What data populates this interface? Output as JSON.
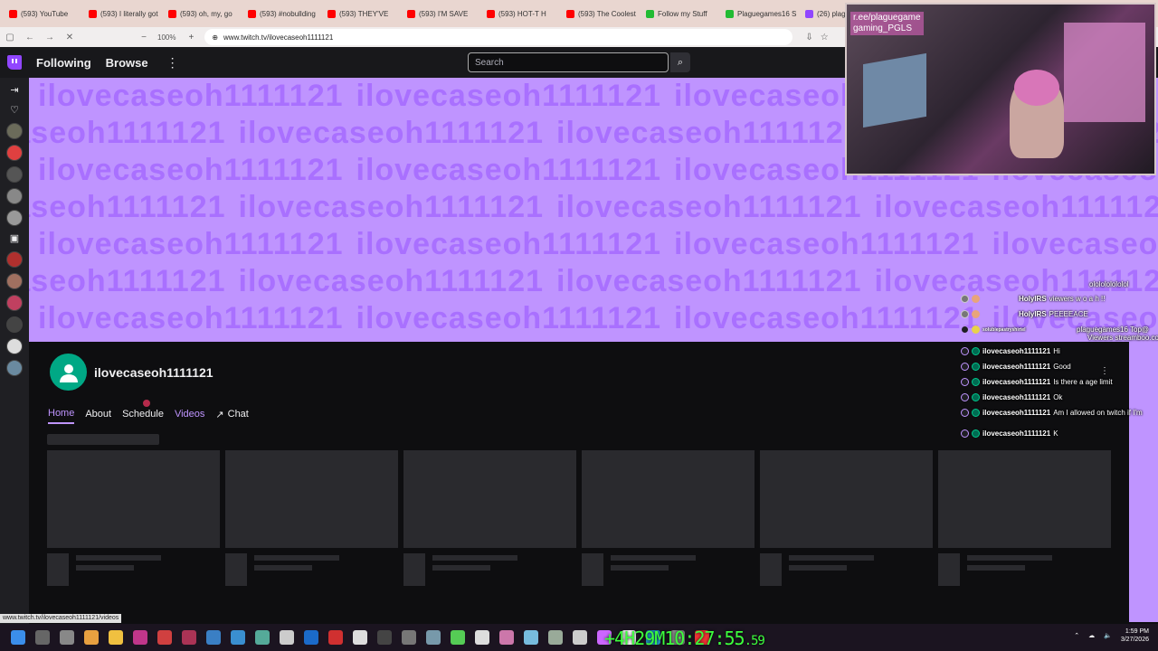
{
  "browser": {
    "tabs": [
      {
        "label": "(593) YouTube",
        "color": "#ff0000"
      },
      {
        "label": "(593) I literally got",
        "color": "#ff0000"
      },
      {
        "label": "(593) oh, my, go",
        "color": "#ff0000"
      },
      {
        "label": "(593) #nobullding",
        "color": "#ff0000"
      },
      {
        "label": "(593) THEY'VE",
        "color": "#ff0000"
      },
      {
        "label": "(593) I'M SAVE",
        "color": "#ff0000"
      },
      {
        "label": "(593) HOT-T H",
        "color": "#ff0000"
      },
      {
        "label": "(593) The Coolest",
        "color": "#ff0000"
      },
      {
        "label": "Follow my Stuff",
        "color": "#22bb33"
      },
      {
        "label": "Plaguegames16 S",
        "color": "#22bb33"
      },
      {
        "label": "(26) plaguegam",
        "color": "#9146ff"
      }
    ],
    "zoom": "100%",
    "url": "www.twitch.tv/ilovecaseoh1111121",
    "status_url": "www.twitch.tv/ilovecaseoh1111121/videos"
  },
  "topnav": {
    "following": "Following",
    "browse": "Browse",
    "more": "⋮",
    "search_placeholder": "Search"
  },
  "banner": {
    "text": "ilovecaseoh1111121"
  },
  "channel": {
    "name": "ilovecaseoh1111121",
    "tabs": {
      "home": "Home",
      "about": "About",
      "schedule": "Schedule",
      "videos": "Videos",
      "chat": "Chat"
    }
  },
  "stream_overlay": {
    "cam_text_1": "r.ee/plaguegame",
    "cam_text_2": "gaming_PGLS",
    "chat": [
      {
        "name": "",
        "text": "ololololololol"
      },
      {
        "name": "HolyIRS",
        "text": "viewers w o a h !!"
      },
      {
        "name": "HolyIRS",
        "text": "PEEEEACE"
      },
      {
        "name": "solublepastryshirtel",
        "text": ""
      },
      {
        "name": "",
        "text": "plaguegames16 Top@"
      },
      {
        "name": "",
        "text": "Viewers streamboo.com"
      },
      {
        "name": "ilovecaseoh1111121",
        "text": "Hi"
      },
      {
        "name": "ilovecaseoh1111121",
        "text": "Good"
      },
      {
        "name": "ilovecaseoh1111121",
        "text": "Is there a age limit"
      },
      {
        "name": "ilovecaseoh1111121",
        "text": "Ok"
      },
      {
        "name": "ilovecaseoh1111121",
        "text": "Am I allowed on twitch if I'm"
      },
      {
        "name": "ilovecaseoh1111121",
        "text": "K"
      }
    ],
    "timer_main": "+4H29M10:27:55",
    "timer_small": ".59"
  },
  "taskbar": {
    "time": "1:59 PM",
    "date": "3/27/2026"
  }
}
